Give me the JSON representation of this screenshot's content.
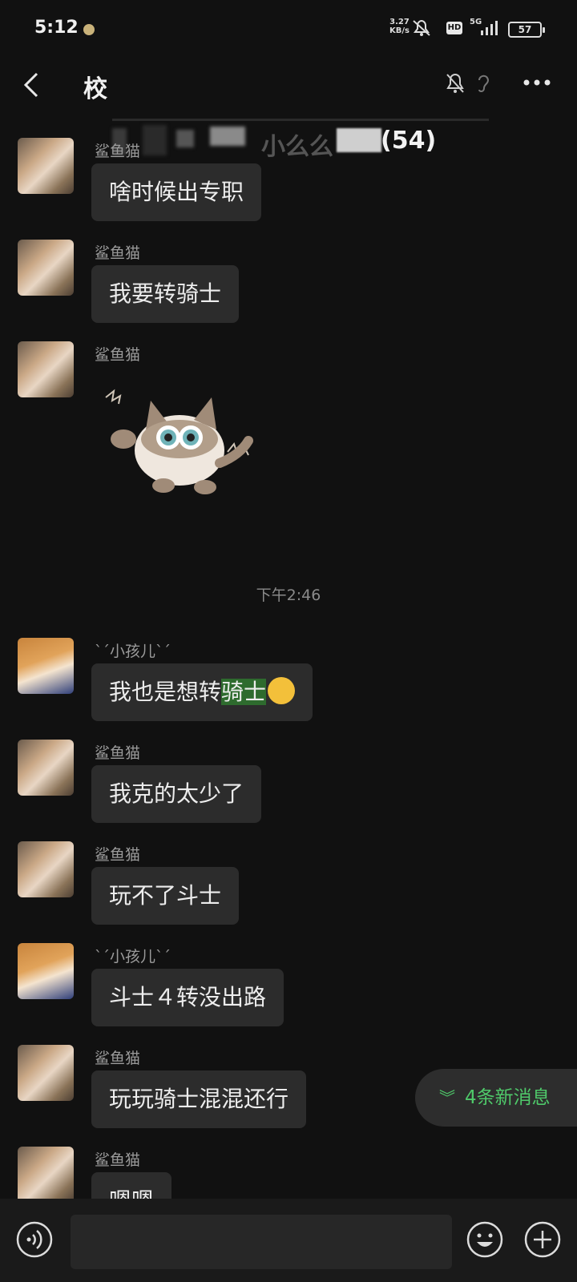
{
  "status_bar": {
    "time": "5:12",
    "net_speed_value": "3.27",
    "net_speed_unit": "KB/s",
    "hd": "HD",
    "network": "5G",
    "battery": "57"
  },
  "header": {
    "title_visible_start": "校",
    "title_visible_mid": "小么么",
    "member_count": "(54)"
  },
  "timestamp": "下午2:46",
  "messages": [
    {
      "sender": "鲨鱼猫",
      "text": "啥时候出专职"
    },
    {
      "sender": "鲨鱼猫",
      "text": "我要转骑士"
    },
    {
      "sender": "鲨鱼猫",
      "sticker": "cat-sticker"
    },
    {
      "sender": "ˋˊ小孩儿ˋˊ",
      "text_before": "我也是想转",
      "text_highlight": "骑士",
      "emoji": "laugh-cry-emoji"
    },
    {
      "sender": "鲨鱼猫",
      "text": "我克的太少了"
    },
    {
      "sender": "鲨鱼猫",
      "text": "玩不了斗士"
    },
    {
      "sender": "ˋˊ小孩儿ˋˊ",
      "text": "斗士４转没出路"
    },
    {
      "sender": "鲨鱼猫",
      "text": "玩玩骑士混混还行"
    },
    {
      "sender": "鲨鱼猫",
      "text": "嗯嗯"
    }
  ],
  "new_messages_pill": "4条新消息",
  "colors": {
    "background": "#111111",
    "bubble": "#2c2c2c",
    "highlight": "#2e6b2e",
    "accent_green": "#4fc96a"
  }
}
